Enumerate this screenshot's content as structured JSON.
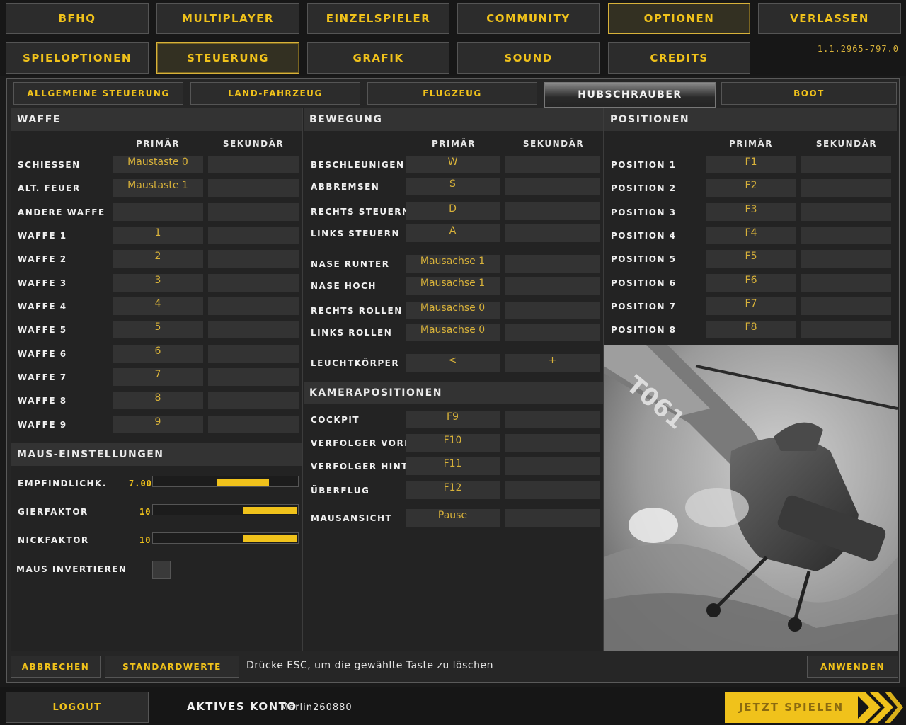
{
  "nav": {
    "bfhq": "BFHQ",
    "multiplayer": "MULTIPLAYER",
    "einzelspieler": "EINZELSPIELER",
    "community": "COMMUNITY",
    "optionen": "OPTIONEN",
    "verlassen": "VERLASSEN"
  },
  "subnav": {
    "spieloptionen": "SPIELOPTIONEN",
    "steuerung": "STEUERUNG",
    "grafik": "GRAFIK",
    "sound": "SOUND",
    "credits": "CREDITS"
  },
  "version": "1.1.2965-797.0",
  "vehicle_tabs": {
    "allgemein": "ALLGEMEINE STEUERUNG",
    "land": "LAND-FAHRZEUG",
    "flug": "FLUGZEUG",
    "hubschrauber": "HUBSCHRAUBER",
    "boot": "BOOT"
  },
  "colheads": {
    "primary": "PRIMÄR",
    "secondary": "SEKUNDÄR"
  },
  "waffe": {
    "title": "WAFFE",
    "rows": [
      {
        "label": "SCHIESSEN",
        "primary": "Maustaste 0",
        "secondary": ""
      },
      {
        "label": "ALT. FEUER",
        "primary": "Maustaste 1",
        "secondary": ""
      },
      {
        "label": "ANDERE WAFFE",
        "primary": "",
        "secondary": ""
      },
      {
        "label": "WAFFE 1",
        "primary": "1",
        "secondary": ""
      },
      {
        "label": "WAFFE 2",
        "primary": "2",
        "secondary": ""
      },
      {
        "label": "WAFFE 3",
        "primary": "3",
        "secondary": ""
      },
      {
        "label": "WAFFE 4",
        "primary": "4",
        "secondary": ""
      },
      {
        "label": "WAFFE 5",
        "primary": "5",
        "secondary": ""
      },
      {
        "label": "WAFFE 6",
        "primary": "6",
        "secondary": ""
      },
      {
        "label": "WAFFE 7",
        "primary": "7",
        "secondary": ""
      },
      {
        "label": "WAFFE 8",
        "primary": "8",
        "secondary": ""
      },
      {
        "label": "WAFFE 9",
        "primary": "9",
        "secondary": ""
      }
    ]
  },
  "maus": {
    "title": "MAUS-EINSTELLUNGEN",
    "sensitivity": {
      "label": "EMPFINDLICHK.",
      "value": "7.00",
      "fraction": 0.36
    },
    "gier": {
      "label": "GIERFAKTOR",
      "value": "10",
      "fraction": 0.37
    },
    "nick": {
      "label": "NICKFAKTOR",
      "value": "10",
      "fraction": 0.37
    },
    "invert": {
      "label": "MAUS INVERTIEREN",
      "checked": false
    }
  },
  "bewegung": {
    "title": "BEWEGUNG",
    "rows": [
      {
        "label": "BESCHLEUNIGEN",
        "primary": "W",
        "secondary": ""
      },
      {
        "label": "ABBREMSEN",
        "primary": "S",
        "secondary": ""
      },
      {
        "label": "RECHTS STEUERN",
        "primary": "D",
        "secondary": ""
      },
      {
        "label": "LINKS STEUERN",
        "primary": "A",
        "secondary": ""
      },
      {
        "label": "NASE RUNTER",
        "primary": "Mausachse 1",
        "secondary": ""
      },
      {
        "label": "NASE HOCH",
        "primary": "Mausachse 1",
        "secondary": ""
      },
      {
        "label": "RECHTS ROLLEN",
        "primary": "Mausachse 0",
        "secondary": ""
      },
      {
        "label": "LINKS ROLLEN",
        "primary": "Mausachse 0",
        "secondary": ""
      },
      {
        "label": "LEUCHTKÖRPER",
        "primary": "<",
        "secondary": "+"
      }
    ]
  },
  "kamera": {
    "title": "KAMERAPOSITIONEN",
    "rows": [
      {
        "label": "COCKPIT",
        "primary": "F9",
        "secondary": ""
      },
      {
        "label": "VERFOLGER VORNE",
        "primary": "F10",
        "secondary": ""
      },
      {
        "label": "VERFOLGER HINTE",
        "primary": "F11",
        "secondary": ""
      },
      {
        "label": "ÜBERFLUG",
        "primary": "F12",
        "secondary": ""
      },
      {
        "label": "MAUSANSICHT",
        "primary": "Pause",
        "secondary": ""
      }
    ]
  },
  "positionen": {
    "title": "POSITIONEN",
    "rows": [
      {
        "label": "POSITION 1",
        "primary": "F1",
        "secondary": ""
      },
      {
        "label": "POSITION 2",
        "primary": "F2",
        "secondary": ""
      },
      {
        "label": "POSITION 3",
        "primary": "F3",
        "secondary": ""
      },
      {
        "label": "POSITION 4",
        "primary": "F4",
        "secondary": ""
      },
      {
        "label": "POSITION 5",
        "primary": "F5",
        "secondary": ""
      },
      {
        "label": "POSITION 6",
        "primary": "F6",
        "secondary": ""
      },
      {
        "label": "POSITION 7",
        "primary": "F7",
        "secondary": ""
      },
      {
        "label": "POSITION 8",
        "primary": "F8",
        "secondary": ""
      }
    ]
  },
  "helicopter_image": {
    "tail_marking": "T061"
  },
  "bottom": {
    "abbrechen": "ABBRECHEN",
    "standardwerte": "STANDARDWERTE",
    "hint": "Drücke ESC, um die gewählte Taste zu löschen",
    "anwenden": "ANWENDEN"
  },
  "footer": {
    "logout": "LOGOUT",
    "account_label": "AKTIVES KONTO",
    "account_name": "Merlin260880",
    "play": "JETZT SPIELEN"
  },
  "colors": {
    "accent": "#f0c21b",
    "panel": "#262626",
    "cell": "#333333"
  }
}
